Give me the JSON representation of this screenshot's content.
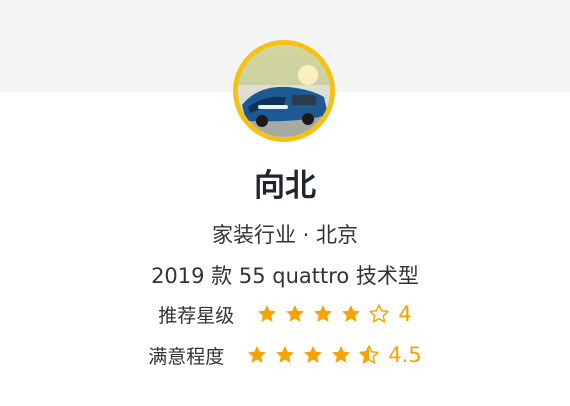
{
  "profile": {
    "name": "向北",
    "industry_location": "家装行业 · 北京",
    "car_model": "2019 款 55 quattro 技术型",
    "avatar_icon": "car-avatar-icon"
  },
  "ratings": {
    "recommend": {
      "label": "推荐星级",
      "value": 4,
      "display": "4"
    },
    "satisfaction": {
      "label": "满意程度",
      "value": 4.5,
      "display": "4.5"
    }
  },
  "colors": {
    "star": "#f5a300",
    "avatar_border": "#f6c014",
    "name": "#1f2530"
  }
}
